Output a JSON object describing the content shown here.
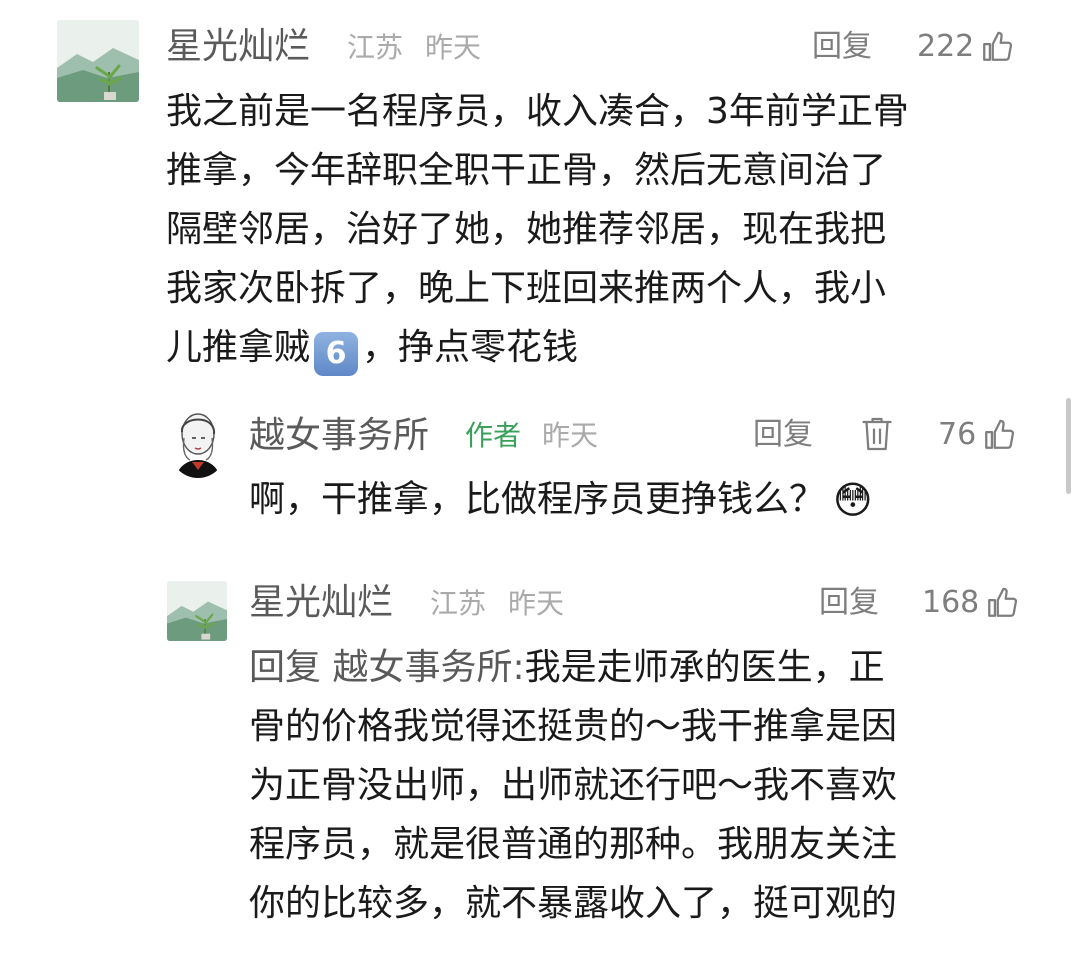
{
  "comments": [
    {
      "user": "星光灿烂",
      "location": "江苏",
      "time": "昨天",
      "reply_label": "回复",
      "likes": "222",
      "lines": [
        "我之前是一名程序员，收入凑合，3年前学正骨",
        "推拿，今年辞职全职干正骨，然后无意间治了",
        "隔壁邻居，治好了她，她推荐邻居，现在我把",
        "我家次卧拆了，晚上下班回来推两个人，我小"
      ],
      "last_line_start": "儿推拿贼",
      "keycap": "6",
      "last_line_end": "，挣点零花钱"
    },
    {
      "user": "越女事务所",
      "author_tag": "作者",
      "time": "昨天",
      "reply_label": "回复",
      "likes": "76",
      "text": "啊，干推拿，比做程序员更挣钱么？",
      "emoji": "😳"
    },
    {
      "user": "星光灿烂",
      "location": "江苏",
      "time": "昨天",
      "reply_label": "回复",
      "likes": "168",
      "reply_prefix": "回复",
      "reply_target": "越女事务所:",
      "line1_rest": "我是走师承的医生，正",
      "lines": [
        "骨的价格我觉得还挺贵的～我干推拿是因",
        "为正骨没出师，出师就还行吧～我不喜欢",
        "程序员，就是很普通的那种。我朋友关注",
        "你的比较多，就不暴露收入了，挺可观的"
      ]
    }
  ],
  "icons": {
    "like": "thumbs-up-outline-icon",
    "delete": "trash-icon"
  },
  "colors": {
    "name": "#5a5a5a",
    "meta": "#aaaaaa",
    "author_tag": "#3aa05a",
    "body": "#1a1a1a"
  }
}
